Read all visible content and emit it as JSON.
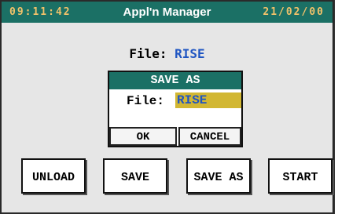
{
  "header": {
    "time": "09:11:42",
    "title": "Appl'n Manager",
    "date": "21/02/00"
  },
  "main": {
    "file_label": "File:",
    "file_value": "RISE"
  },
  "dialog": {
    "title": "SAVE AS",
    "file_label": "File:",
    "file_value": "RISE",
    "ok_label": "OK",
    "cancel_label": "CANCEL"
  },
  "buttons": {
    "unload": "UNLOAD",
    "save": "SAVE",
    "save_as": "SAVE AS",
    "start": "START"
  },
  "colors": {
    "title_bar": "#1b7065",
    "clock_text": "#f2c26a",
    "value_text": "#1f55c2",
    "input_highlight": "#d2b732"
  }
}
